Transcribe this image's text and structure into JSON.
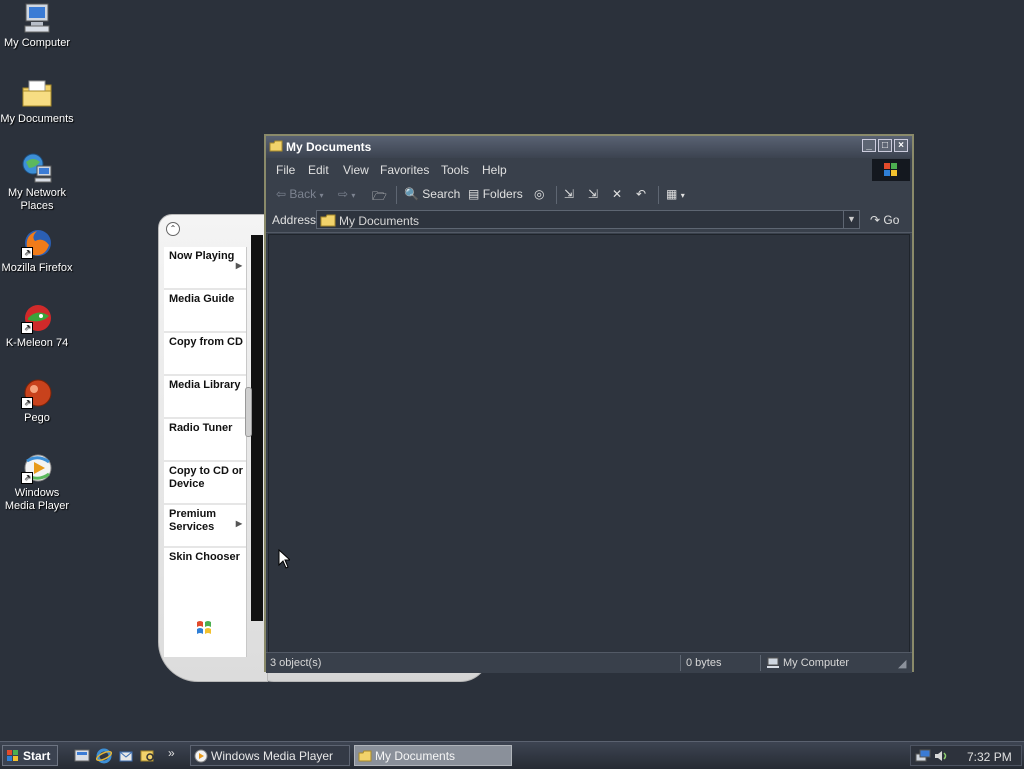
{
  "desktop": {
    "icons": [
      {
        "label": "My Computer"
      },
      {
        "label": "My Documents"
      },
      {
        "label": "My Network Places"
      },
      {
        "label": "Mozilla Firefox"
      },
      {
        "label": "K-Meleon 74"
      },
      {
        "label": "Pego"
      },
      {
        "label": "Windows Media Player"
      }
    ]
  },
  "wmp": {
    "menu": [
      {
        "label": "Now Playing",
        "has_arrow": true
      },
      {
        "label": "Media Guide"
      },
      {
        "label": "Copy from CD"
      },
      {
        "label": "Media Library"
      },
      {
        "label": "Radio Tuner"
      },
      {
        "label": "Copy to CD or Device"
      },
      {
        "label": "Premium Services",
        "has_arrow": true
      },
      {
        "label": "Skin Chooser"
      }
    ]
  },
  "explorer": {
    "title": "My Documents",
    "menu": [
      "File",
      "Edit",
      "View",
      "Favorites",
      "Tools",
      "Help"
    ],
    "toolbar": {
      "back": "Back",
      "search": "Search",
      "folders": "Folders"
    },
    "address": {
      "label": "Address",
      "value": "My Documents",
      "go": "Go"
    },
    "status": {
      "objects": "3 object(s)",
      "size": "0 bytes",
      "zone": "My Computer"
    }
  },
  "taskbar": {
    "start": "Start",
    "tasks": [
      {
        "label": "Windows Media Player",
        "active": false
      },
      {
        "label": "My Documents",
        "active": true
      }
    ],
    "overflow": "»",
    "clock": "7:32 PM"
  },
  "colors": {
    "desktop": "#2b313b",
    "window": "#39404b",
    "titlebar": "#596273"
  }
}
